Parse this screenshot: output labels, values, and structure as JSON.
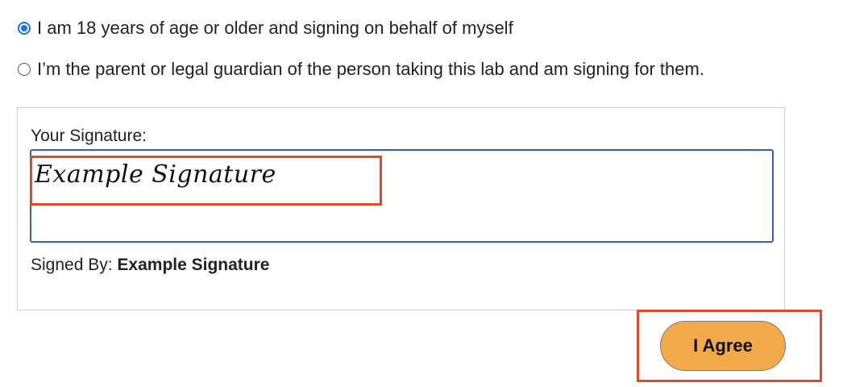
{
  "consent": {
    "options": [
      {
        "label": "I am 18 years of age or older and signing on behalf of myself",
        "selected": true
      },
      {
        "label": "I’m the parent or legal guardian of the person taking this lab and am signing for them.",
        "selected": false
      }
    ]
  },
  "signature": {
    "label": "Your Signature:",
    "value": "Example Signature",
    "signed_by_label": "Signed By:",
    "signed_by_value": "Example Signature"
  },
  "actions": {
    "agree_label": "I Agree"
  },
  "colors": {
    "radio_accent": "#1a73e8",
    "input_border": "#2f5fc4",
    "button_bg": "#f2a94a",
    "highlight": "#e04a2b"
  }
}
